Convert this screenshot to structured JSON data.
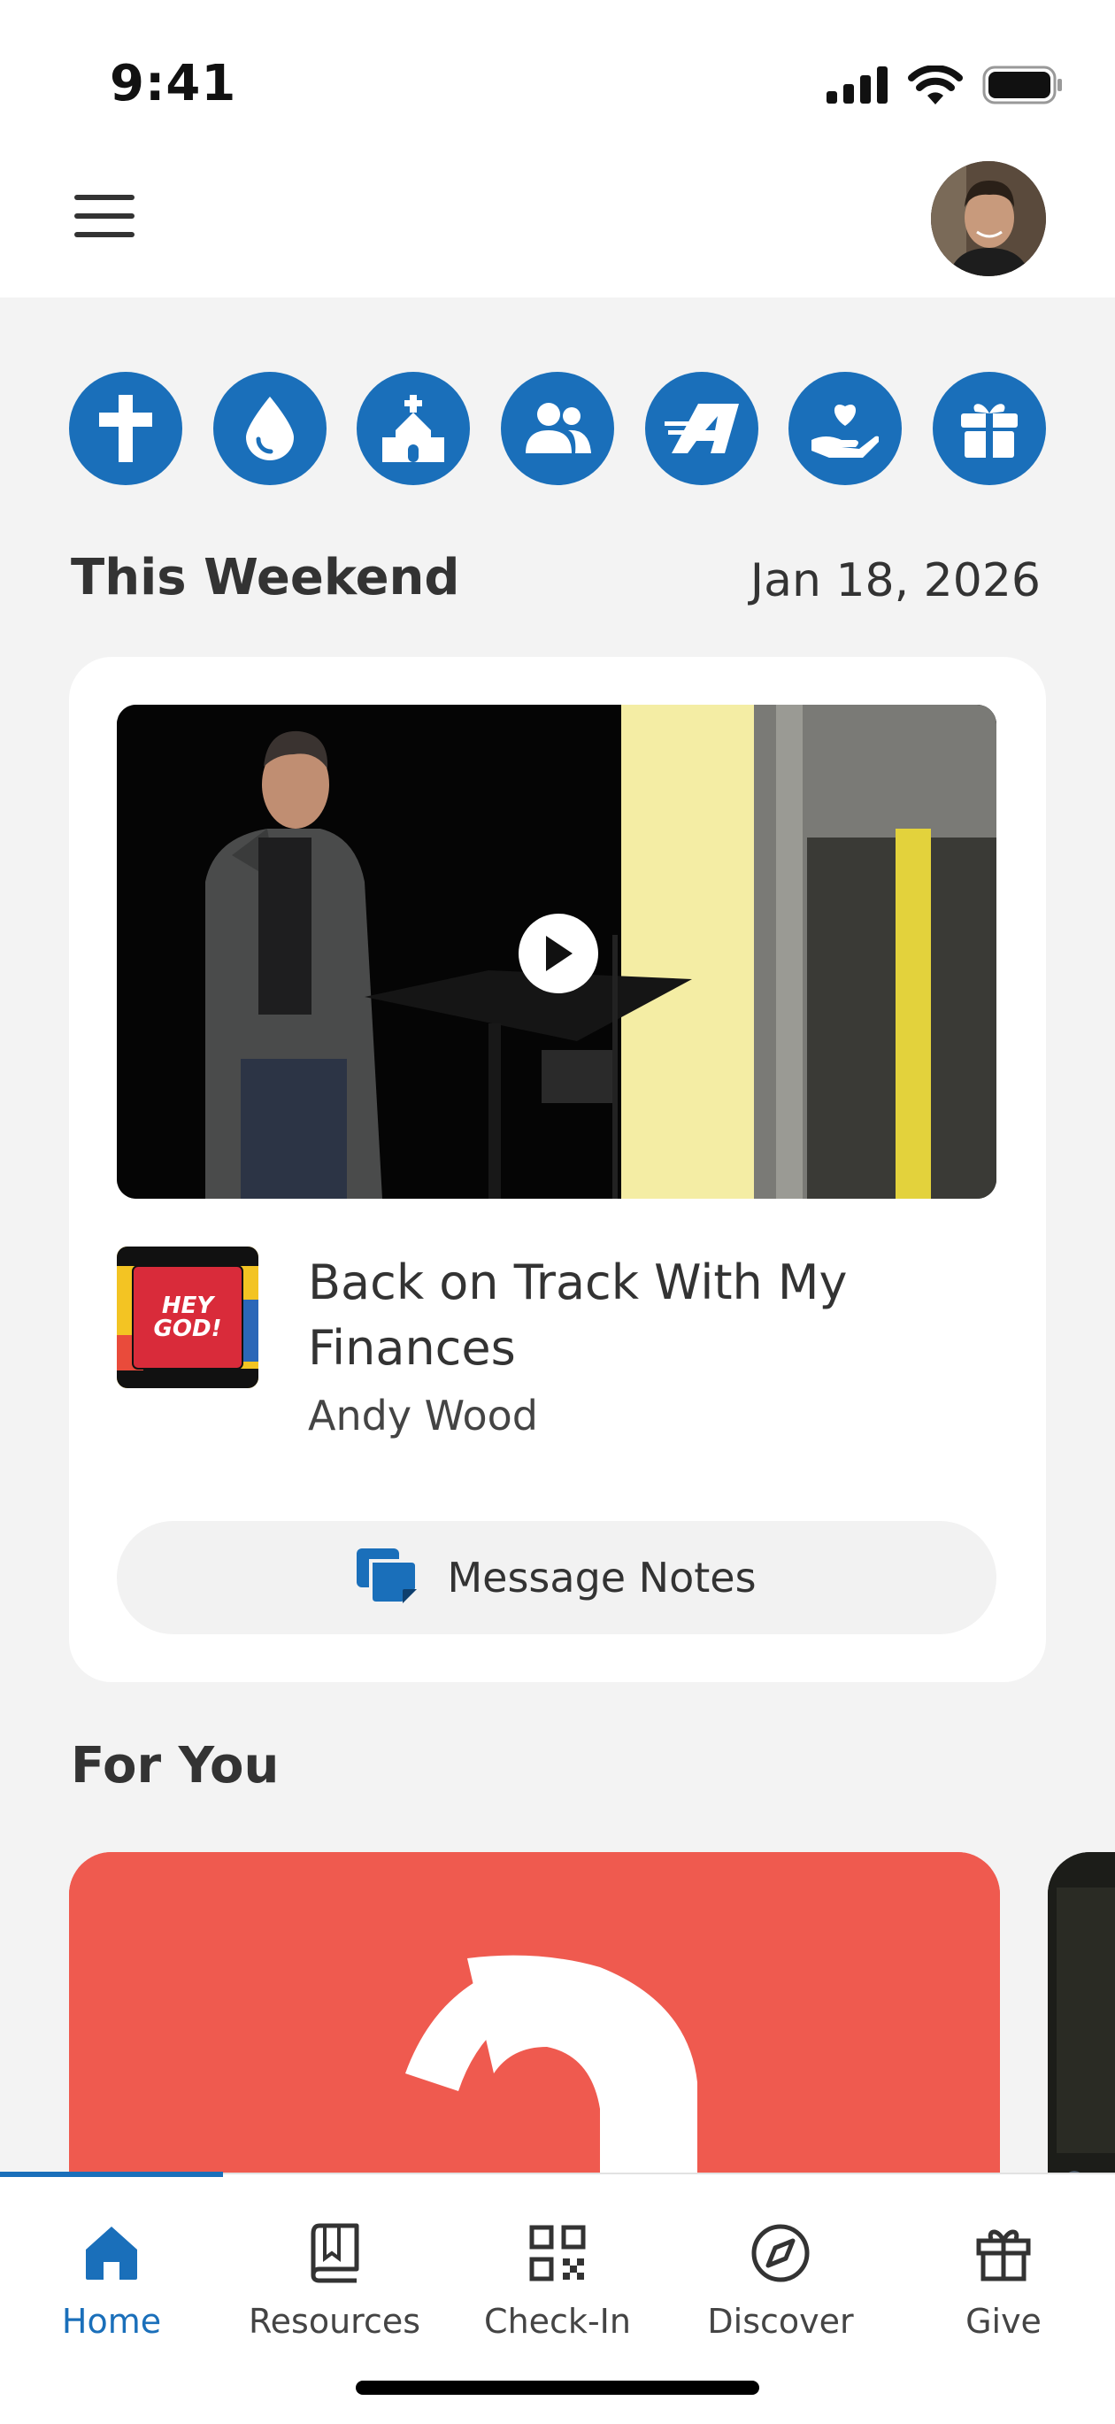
{
  "status_bar": {
    "time": "9:41"
  },
  "header": {
    "menu_icon": "hamburger-icon",
    "avatar": "user-avatar"
  },
  "quick_actions": [
    {
      "icon": "cross-icon"
    },
    {
      "icon": "water-drop-icon"
    },
    {
      "icon": "church-icon"
    },
    {
      "icon": "people-icon"
    },
    {
      "icon": "a-logo-icon"
    },
    {
      "icon": "hand-heart-icon"
    },
    {
      "icon": "gift-icon"
    }
  ],
  "this_weekend": {
    "title": "This Weekend",
    "date": "Jan 18, 2026",
    "sermon_title": "Back on Track With My Finances",
    "speaker": "Andy Wood",
    "thumbnail_text": "HEY GOD!",
    "notes_label": "Message Notes"
  },
  "for_you": {
    "title": "For You"
  },
  "tabs": [
    {
      "label": "Home",
      "icon": "home-icon",
      "active": true
    },
    {
      "label": "Resources",
      "icon": "book-icon"
    },
    {
      "label": "Check-In",
      "icon": "qr-code-icon"
    },
    {
      "label": "Discover",
      "icon": "compass-icon"
    },
    {
      "label": "Give",
      "icon": "gift-icon"
    }
  ],
  "colors": {
    "accent": "#1a6fba",
    "card_red": "#ef5a4f",
    "background": "#f3f3f3"
  }
}
